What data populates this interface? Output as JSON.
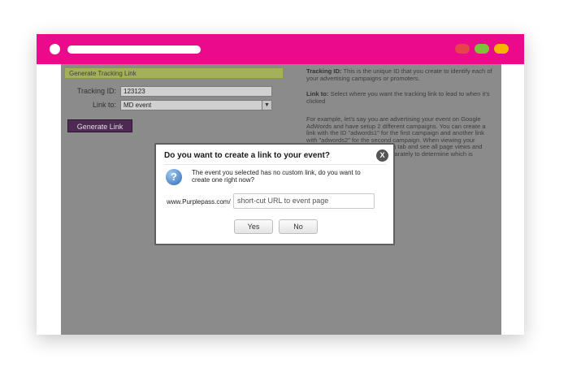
{
  "window": {
    "colors": {
      "titlebar": "#ec0a8c",
      "close": "#e8434a",
      "minimize": "#7cc23a",
      "maximize": "#f7b500"
    }
  },
  "form": {
    "header": "Generate Tracking Link",
    "tracking_id_label": "Tracking ID:",
    "tracking_id_value": "123123",
    "link_to_label": "Link to:",
    "link_to_value": "MD event",
    "generate_button": "Generate Link"
  },
  "info": {
    "tracking_id_title": "Tracking ID:",
    "tracking_id_text": "This is the unique ID that you create to identify each of your advertising campaigns or promoters.",
    "link_to_title": "Link to:",
    "link_to_text": "Select where you want the tracking link to lead to when it's clicked",
    "example_line1": "For example, let's say you are advertising your event on Google",
    "example_line2": "AdWords and have setup 2 different campaigns. You can create a",
    "example_line3": "link with the ID \"adwords1\" for the first campaign and another link",
    "example_line4": "with \"adwords2\" for the second campaign. When viewing your",
    "example_line5": "ing tab and see all page views and",
    "example_line6": "eparately to determine which is"
  },
  "dialog": {
    "title": "Do you want to create a link to your event?",
    "close_label": "X",
    "message": "The event you selected has no custom link, do you want to create one right now?",
    "url_prefix": "www.Purplepass.com/",
    "url_placeholder": "short-cut URL to event page",
    "yes_label": "Yes",
    "no_label": "No",
    "question_icon": "question-icon"
  }
}
